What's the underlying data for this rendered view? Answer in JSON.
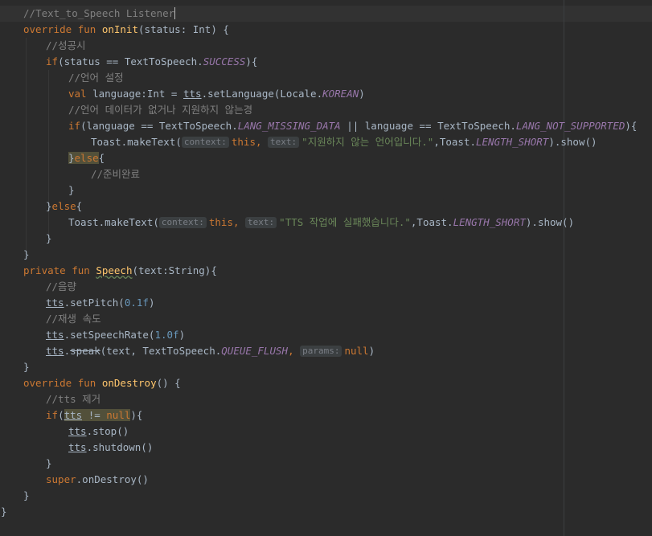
{
  "code": {
    "l1_comment": "//Text_to_Speech Listener",
    "kw_override": "override",
    "kw_fun": "fun",
    "fn_onInit": "onInit",
    "l2_params": "(status: Int) {",
    "l3_comment": "//성공시",
    "kw_if": "if",
    "l4_a": "(status == TextToSpeech.",
    "c_success": "SUCCESS",
    "l4_b": "){",
    "l5_comment": "//언어 설정",
    "kw_val": "val",
    "l6_a": " language:Int = ",
    "id_tts": "tts",
    "l6_b": ".setLanguage(Locale.",
    "c_korean": "KOREAN",
    "paren_close": ")",
    "l7_comment": "//언어 데이터가 없거나 지원하지 않는경",
    "l8_a": "(language == TextToSpeech.",
    "c_missing": "LANG_MISSING_DATA",
    "l8_b": " || language == TextToSpeech.",
    "c_notsupported": "LANG_NOT_SUPPORTED",
    "l8_c": "){",
    "toast_make": "Toast.makeText(",
    "hint_context": "context:",
    "kw_this": "this",
    "comma_space": ", ",
    "hint_text": "text:",
    "str_unsupported": "\"지원하지 않는 언어입니다.\"",
    "toast_mid": ",Toast.",
    "c_short": "LENGTH_SHORT",
    "toast_end": ").show()",
    "brace_close_open": "}",
    "kw_else": "else",
    "brace_open": "{",
    "l11_comment": "//준비완료",
    "brace_close": "}",
    "str_fail": "\"TTS 작업에 실패했습니다.\"",
    "kw_private": "private",
    "fn_speech": "Speech",
    "l17_params": "(text:String){",
    "l18_comment": "//음량",
    "l19_a": ".setPitch(",
    "num_pitch": "0.1f",
    "l20_comment": "//재생 속도",
    "l21_a": ".setSpeechRate(",
    "num_rate": "1.0f",
    "dot": ".",
    "fn_speak": "speak",
    "l22_a": "(text, TextToSpeech.",
    "c_queue": "QUEUE_FLUSH",
    "hint_params": "params:",
    "kw_null": "null",
    "fn_onDestroy": "onDestroy",
    "l24_params": "() {",
    "l25_comment": "//tts 제거",
    "paren_open": "(",
    "neq": " != ",
    "l26_end": "){",
    "l27_a": ".stop()",
    "l28_a": ".shutdown()",
    "kw_super": "super",
    "l30_a": ".onDestroy()"
  },
  "colors": {
    "background": "#2b2b2b",
    "keyword": "#cc7832",
    "function": "#ffc66d",
    "comment": "#808080",
    "number": "#6897bb",
    "string": "#6a8759",
    "constant": "#9876aa",
    "plain": "#a9b7c6"
  }
}
